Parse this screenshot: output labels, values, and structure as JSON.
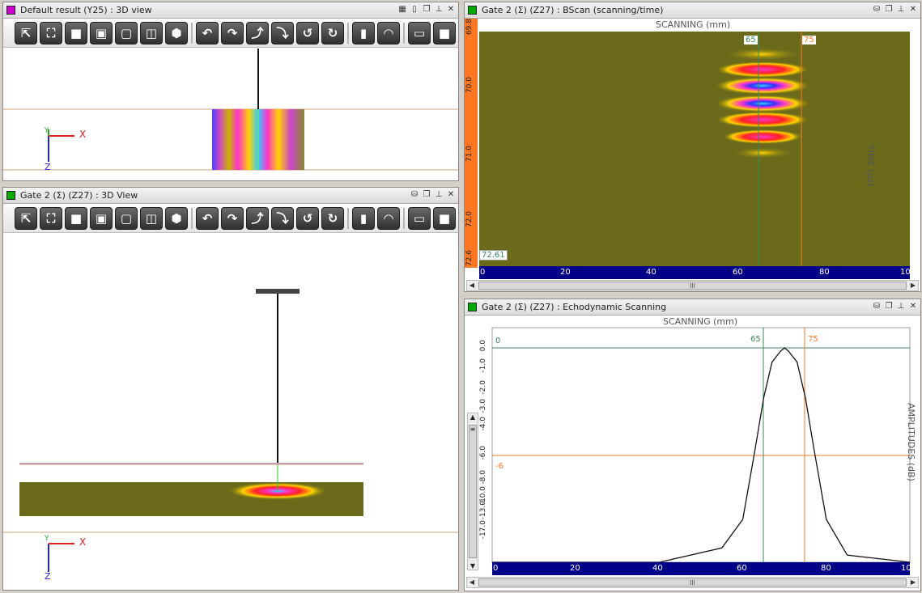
{
  "panels": {
    "top_left": {
      "title": "Default result (Y25) : 3D view",
      "swatch_color": "#cc00cc",
      "axes": {
        "x": "X",
        "y": "Y",
        "z": "Z"
      }
    },
    "bottom_left": {
      "title": "Gate 2 (Σ) (Z27) : 3D View",
      "swatch_color": "#00aa00",
      "axes": {
        "x": "X",
        "y": "Y",
        "z": "Z"
      }
    },
    "bscan": {
      "title": "Gate 2 (Σ) (Z27) : BScan (scanning/time)",
      "swatch_color": "#00aa00",
      "x_axis_title": "SCANNING (mm)",
      "y_axis_title": "TIME (μs)",
      "cursor_a": "65",
      "cursor_b": "75",
      "readout": "72.61",
      "y_ticks": [
        "69.8",
        "70.0",
        "71.0",
        "72.0",
        "72.6"
      ],
      "x_ticks": [
        "0",
        "20",
        "40",
        "60",
        "80",
        "10"
      ]
    },
    "echo": {
      "title": "Gate 2 (Σ) (Z27) : Echodynamic Scanning",
      "swatch_color": "#00aa00",
      "x_axis_title": "SCANNING (mm)",
      "y_axis_title": "AMPLITUDES (dB)",
      "cursor_a": "65",
      "cursor_b": "75",
      "ref_zero": "0",
      "ref_minus6": "-6",
      "y_ticks": [
        "0.0",
        "-1.0",
        "-2.0",
        "-3.0",
        "-4.0",
        "-6.0",
        "-8.0",
        "-10.0",
        "-13.0",
        "-17.0"
      ],
      "x_ticks": [
        "0",
        "20",
        "40",
        "60",
        "80",
        "10"
      ]
    }
  },
  "toolbar_icons": [
    "select-arrow-icon",
    "fit-view-icon",
    "front-cube-icon",
    "side-cube-icon",
    "wire-cube-icon",
    "wire-cube-2-icon",
    "iso-cube-icon",
    "rotate-left-icon",
    "rotate-right-icon",
    "rotate-up-icon",
    "rotate-down-icon",
    "rotate-ccw-icon",
    "rotate-cw-icon",
    "ruler-icon",
    "protractor-icon",
    "box-outline-icon",
    "box-solid-icon",
    "hatch-icon"
  ],
  "scroll_thumb": "III",
  "chart_data": {
    "type": "line",
    "title": "SCANNING (mm)",
    "xlabel": "SCANNING (mm)",
    "ylabel": "AMPLITUDES (dB)",
    "x": [
      0,
      40,
      55,
      60,
      63,
      65,
      67,
      69,
      70,
      71,
      73,
      75,
      77,
      80,
      85,
      100
    ],
    "series": [
      {
        "values": [
          -30,
          -30,
          -28,
          -24,
          -14,
          -7,
          -2,
          -0.5,
          0,
          -0.5,
          -2,
          -7,
          -14,
          -24,
          -29,
          -30
        ]
      }
    ],
    "xlim": [
      0,
      100
    ],
    "ylim": [
      -30,
      1
    ]
  }
}
